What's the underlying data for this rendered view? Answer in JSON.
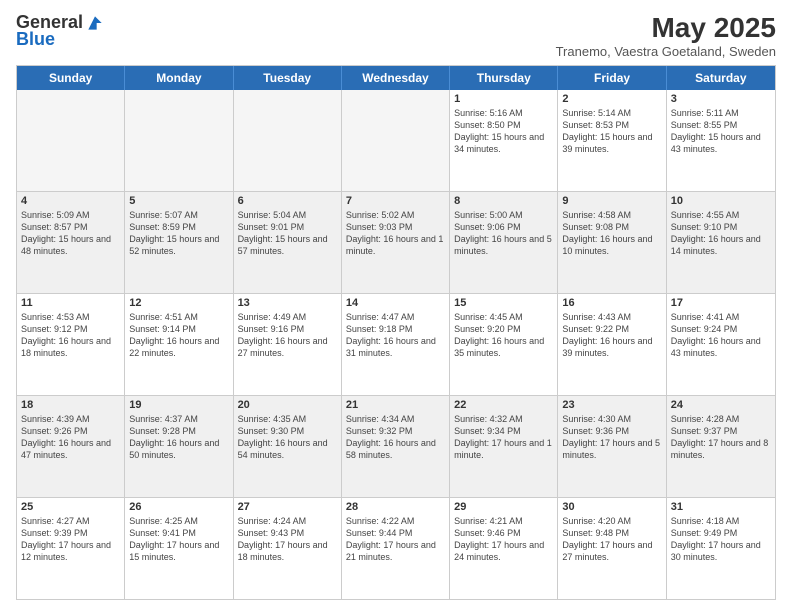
{
  "header": {
    "logo_general": "General",
    "logo_blue": "Blue",
    "title": "May 2025",
    "location": "Tranemo, Vaestra Goetaland, Sweden"
  },
  "weekdays": [
    "Sunday",
    "Monday",
    "Tuesday",
    "Wednesday",
    "Thursday",
    "Friday",
    "Saturday"
  ],
  "rows": [
    [
      {
        "day": "",
        "info": "",
        "empty": true
      },
      {
        "day": "",
        "info": "",
        "empty": true
      },
      {
        "day": "",
        "info": "",
        "empty": true
      },
      {
        "day": "",
        "info": "",
        "empty": true
      },
      {
        "day": "1",
        "info": "Sunrise: 5:16 AM\nSunset: 8:50 PM\nDaylight: 15 hours and 34 minutes."
      },
      {
        "day": "2",
        "info": "Sunrise: 5:14 AM\nSunset: 8:53 PM\nDaylight: 15 hours and 39 minutes."
      },
      {
        "day": "3",
        "info": "Sunrise: 5:11 AM\nSunset: 8:55 PM\nDaylight: 15 hours and 43 minutes."
      }
    ],
    [
      {
        "day": "4",
        "info": "Sunrise: 5:09 AM\nSunset: 8:57 PM\nDaylight: 15 hours and 48 minutes."
      },
      {
        "day": "5",
        "info": "Sunrise: 5:07 AM\nSunset: 8:59 PM\nDaylight: 15 hours and 52 minutes."
      },
      {
        "day": "6",
        "info": "Sunrise: 5:04 AM\nSunset: 9:01 PM\nDaylight: 15 hours and 57 minutes."
      },
      {
        "day": "7",
        "info": "Sunrise: 5:02 AM\nSunset: 9:03 PM\nDaylight: 16 hours and 1 minute."
      },
      {
        "day": "8",
        "info": "Sunrise: 5:00 AM\nSunset: 9:06 PM\nDaylight: 16 hours and 5 minutes."
      },
      {
        "day": "9",
        "info": "Sunrise: 4:58 AM\nSunset: 9:08 PM\nDaylight: 16 hours and 10 minutes."
      },
      {
        "day": "10",
        "info": "Sunrise: 4:55 AM\nSunset: 9:10 PM\nDaylight: 16 hours and 14 minutes."
      }
    ],
    [
      {
        "day": "11",
        "info": "Sunrise: 4:53 AM\nSunset: 9:12 PM\nDaylight: 16 hours and 18 minutes."
      },
      {
        "day": "12",
        "info": "Sunrise: 4:51 AM\nSunset: 9:14 PM\nDaylight: 16 hours and 22 minutes."
      },
      {
        "day": "13",
        "info": "Sunrise: 4:49 AM\nSunset: 9:16 PM\nDaylight: 16 hours and 27 minutes."
      },
      {
        "day": "14",
        "info": "Sunrise: 4:47 AM\nSunset: 9:18 PM\nDaylight: 16 hours and 31 minutes."
      },
      {
        "day": "15",
        "info": "Sunrise: 4:45 AM\nSunset: 9:20 PM\nDaylight: 16 hours and 35 minutes."
      },
      {
        "day": "16",
        "info": "Sunrise: 4:43 AM\nSunset: 9:22 PM\nDaylight: 16 hours and 39 minutes."
      },
      {
        "day": "17",
        "info": "Sunrise: 4:41 AM\nSunset: 9:24 PM\nDaylight: 16 hours and 43 minutes."
      }
    ],
    [
      {
        "day": "18",
        "info": "Sunrise: 4:39 AM\nSunset: 9:26 PM\nDaylight: 16 hours and 47 minutes."
      },
      {
        "day": "19",
        "info": "Sunrise: 4:37 AM\nSunset: 9:28 PM\nDaylight: 16 hours and 50 minutes."
      },
      {
        "day": "20",
        "info": "Sunrise: 4:35 AM\nSunset: 9:30 PM\nDaylight: 16 hours and 54 minutes."
      },
      {
        "day": "21",
        "info": "Sunrise: 4:34 AM\nSunset: 9:32 PM\nDaylight: 16 hours and 58 minutes."
      },
      {
        "day": "22",
        "info": "Sunrise: 4:32 AM\nSunset: 9:34 PM\nDaylight: 17 hours and 1 minute."
      },
      {
        "day": "23",
        "info": "Sunrise: 4:30 AM\nSunset: 9:36 PM\nDaylight: 17 hours and 5 minutes."
      },
      {
        "day": "24",
        "info": "Sunrise: 4:28 AM\nSunset: 9:37 PM\nDaylight: 17 hours and 8 minutes."
      }
    ],
    [
      {
        "day": "25",
        "info": "Sunrise: 4:27 AM\nSunset: 9:39 PM\nDaylight: 17 hours and 12 minutes."
      },
      {
        "day": "26",
        "info": "Sunrise: 4:25 AM\nSunset: 9:41 PM\nDaylight: 17 hours and 15 minutes."
      },
      {
        "day": "27",
        "info": "Sunrise: 4:24 AM\nSunset: 9:43 PM\nDaylight: 17 hours and 18 minutes."
      },
      {
        "day": "28",
        "info": "Sunrise: 4:22 AM\nSunset: 9:44 PM\nDaylight: 17 hours and 21 minutes."
      },
      {
        "day": "29",
        "info": "Sunrise: 4:21 AM\nSunset: 9:46 PM\nDaylight: 17 hours and 24 minutes."
      },
      {
        "day": "30",
        "info": "Sunrise: 4:20 AM\nSunset: 9:48 PM\nDaylight: 17 hours and 27 minutes."
      },
      {
        "day": "31",
        "info": "Sunrise: 4:18 AM\nSunset: 9:49 PM\nDaylight: 17 hours and 30 minutes."
      }
    ]
  ]
}
